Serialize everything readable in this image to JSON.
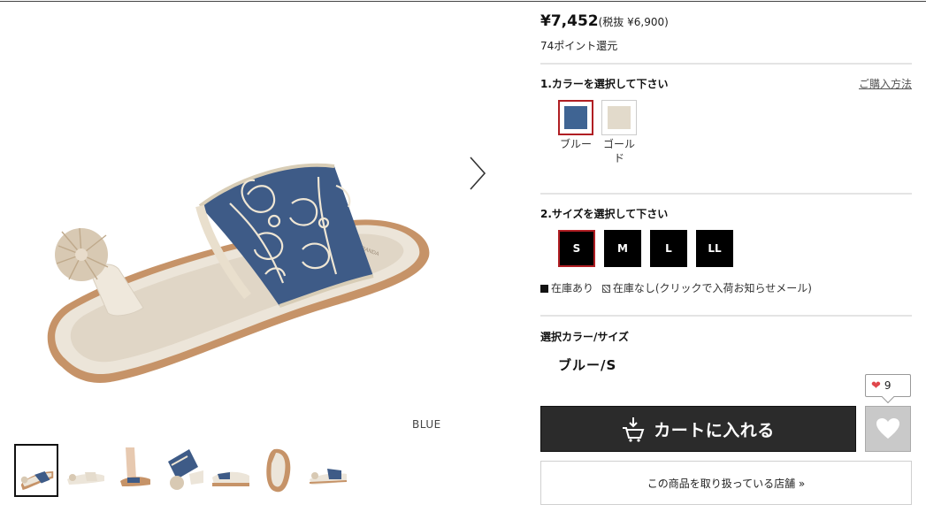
{
  "price": {
    "main": "¥7,452",
    "tax_note": "(税抜 ¥6,900)"
  },
  "points": "74ポイント還元",
  "color_section": {
    "title": "1.カラーを選択して下さい",
    "howto_link": "ご購入方法",
    "options": [
      {
        "label": "ブルー",
        "chip_color": "#3f6493",
        "selected": true
      },
      {
        "label": "ゴールド",
        "chip_color": "#e2dacb",
        "selected": false
      }
    ]
  },
  "size_section": {
    "title": "2.サイズを選択して下さい",
    "options": [
      {
        "label": "S",
        "selected": true
      },
      {
        "label": "M",
        "selected": false
      },
      {
        "label": "L",
        "selected": false
      },
      {
        "label": "LL",
        "selected": false
      }
    ],
    "legend_in_stock": "在庫あり",
    "legend_out_of_stock": "在庫なし(クリックで入荷お知らせメール)"
  },
  "selection": {
    "title": "選択カラー/サイズ",
    "value": "ブルー/S"
  },
  "favorite": {
    "count": "9"
  },
  "cart_button": "カートに入れる",
  "store_button": "この商品を取り扱っている店舗 »",
  "image": {
    "color_caption": "BLUE"
  },
  "colors": {
    "accent_red": "#b01e23",
    "cart_bg": "#2b2b2b",
    "denim": "#3f5c86",
    "cream": "#ebe3d6",
    "tan": "#c69368"
  }
}
